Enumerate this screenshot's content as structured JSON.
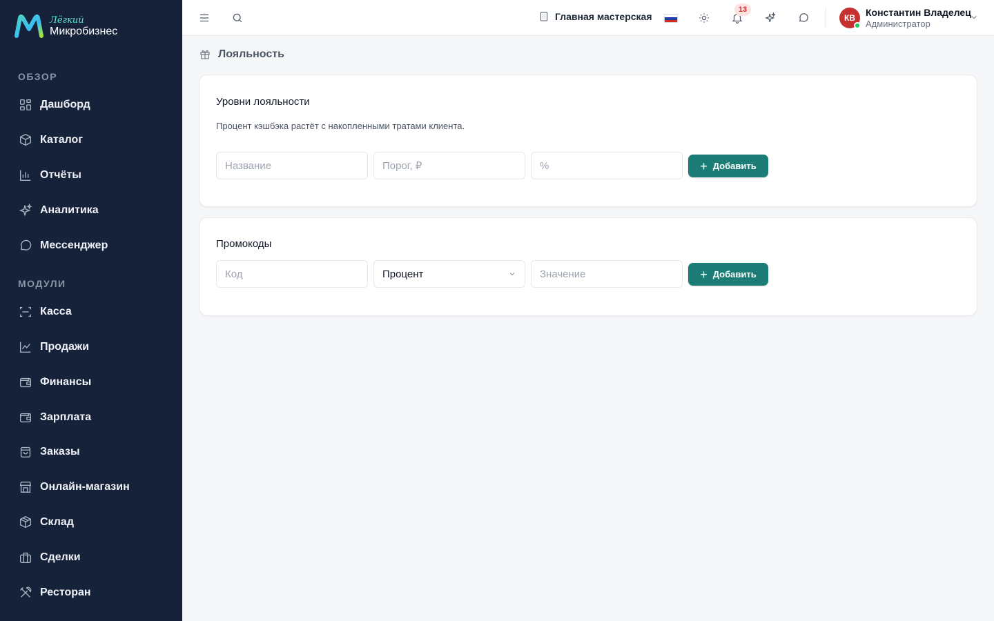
{
  "brand": {
    "line1": "Лёгкий",
    "line2": "Микробизнес"
  },
  "sidebar": {
    "section_overview": "ОБЗОР",
    "overview_items": [
      {
        "label": "Дашборд",
        "icon": "grid-icon"
      },
      {
        "label": "Каталог",
        "icon": "box-tag-icon"
      },
      {
        "label": "Отчёты",
        "icon": "bar-chart-icon"
      },
      {
        "label": "Аналитика",
        "icon": "sparkle-icon"
      },
      {
        "label": "Мессенджер",
        "icon": "chat-icon"
      }
    ],
    "section_modules": "МОДУЛИ",
    "module_items": [
      {
        "label": "Касса",
        "icon": "scan-icon"
      },
      {
        "label": "Продажи",
        "icon": "line-chart-icon"
      },
      {
        "label": "Финансы",
        "icon": "wallet-icon"
      },
      {
        "label": "Зарплата",
        "icon": "wallet-icon"
      },
      {
        "label": "Заказы",
        "icon": "bag-icon"
      },
      {
        "label": "Онлайн-магазин",
        "icon": "store-icon"
      },
      {
        "label": "Склад",
        "icon": "package-icon"
      },
      {
        "label": "Сделки",
        "icon": "briefcase-icon"
      },
      {
        "label": "Ресторан",
        "icon": "utensils-icon"
      }
    ]
  },
  "topbar": {
    "workshop": "Главная мастерская",
    "notifications_count": "13",
    "user_initials": "КВ",
    "user_name": "Константин Владелец",
    "user_role": "Администратор",
    "flag_colors": [
      "#ffffff",
      "#1c3fa8",
      "#d52b1e"
    ]
  },
  "page": {
    "title": "Лояльность"
  },
  "loyalty": {
    "title": "Уровни лояльности",
    "subtitle": "Процент кэшбэка растёт с накопленными тратами клиента.",
    "name_placeholder": "Название",
    "threshold_placeholder": "Порог, ₽",
    "percent_placeholder": "%",
    "add_label": "Добавить"
  },
  "promo": {
    "title": "Промокоды",
    "code_placeholder": "Код",
    "type_value": "Процент",
    "value_placeholder": "Значение",
    "add_label": "Добавить"
  },
  "colors": {
    "sidebar_bg": "#16213a",
    "accent": "#1b7d75",
    "badge_bg": "#fde2e2",
    "badge_text": "#dc2626"
  }
}
